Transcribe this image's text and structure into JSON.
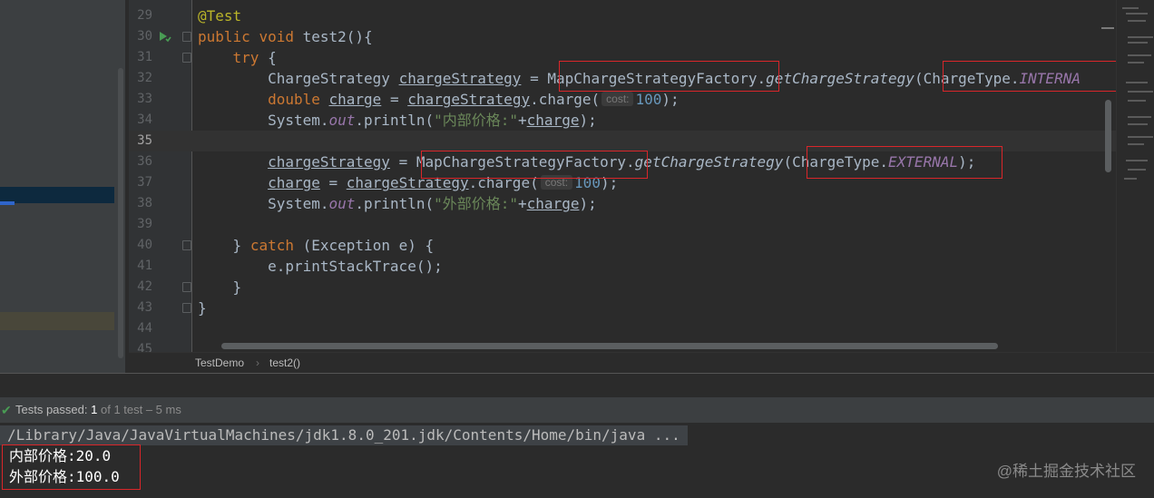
{
  "editor": {
    "lines": [
      {
        "n": "29"
      },
      {
        "n": "30"
      },
      {
        "n": "31"
      },
      {
        "n": "32"
      },
      {
        "n": "33"
      },
      {
        "n": "34"
      },
      {
        "n": "35"
      },
      {
        "n": "36"
      },
      {
        "n": "37"
      },
      {
        "n": "38"
      },
      {
        "n": "39"
      },
      {
        "n": "40"
      },
      {
        "n": "41"
      },
      {
        "n": "42"
      },
      {
        "n": "43"
      },
      {
        "n": "44"
      },
      {
        "n": "45"
      }
    ],
    "code": {
      "l29_annotation": "@Test",
      "l30_public": "public",
      "l30_void": "void",
      "l30_method": "test2",
      "l30_rest": "(){",
      "l31_try": "try",
      "l31_brace": "{",
      "l32_type": "ChargeStrategy",
      "l32_var": "chargeStrategy",
      "l32_eq": "=",
      "l32_factory": "MapChargeStrategyFactory",
      "l32_dot": ".",
      "l32_call": "getChargeStrategy",
      "l32_arg": "(ChargeType.",
      "l32_const": "INTERNA",
      "l33_double": "double",
      "l33_var": "charge",
      "l33_eq": "=",
      "l33_obj": "chargeStrategy",
      "l33_call": ".charge(",
      "l33_hint": "cost:",
      "l33_num": "100",
      "l33_end": ");",
      "l34_system": "System.",
      "l34_out": "out",
      "l34_println": ".println(",
      "l34_str": "\"内部价格:\"",
      "l34_plus": "+",
      "l34_var": "charge",
      "l34_end": ");",
      "l36_var": "chargeStrategy",
      "l36_eq": "=",
      "l36_factory": "MapChargeStrategyFactory",
      "l36_dot": ".",
      "l36_call": "getChargeStrategy",
      "l36_arg": "(ChargeType.",
      "l36_const": "EXTERNAL",
      "l36_end": ");",
      "l37_var": "charge",
      "l37_eq": "=",
      "l37_obj": "chargeStrategy",
      "l37_call": ".charge(",
      "l37_hint": "cost:",
      "l37_num": "100",
      "l37_end": ");",
      "l38_system": "System.",
      "l38_out": "out",
      "l38_println": ".println(",
      "l38_str": "\"外部价格:\"",
      "l38_plus": "+",
      "l38_var": "charge",
      "l38_end": ");",
      "l40_close": "}",
      "l40_catch": "catch",
      "l40_rest": "(Exception e) {",
      "l41_call": "e.printStackTrace();",
      "l42_close": "}",
      "l43_close": "}"
    }
  },
  "breadcrumb": {
    "class_name": "TestDemo",
    "separator": "›",
    "method_name": "test2()"
  },
  "run": {
    "status_bold": "Tests passed:",
    "status_count": "1",
    "status_rest": "of 1 test – 5 ms",
    "command": "/Library/Java/JavaVirtualMachines/jdk1.8.0_201.jdk/Contents/Home/bin/java ...",
    "output_lines": [
      "内部价格:20.0",
      "外部价格:100.0"
    ]
  },
  "watermark": "@稀土掘金技术社区",
  "colors": {
    "keyword": "#cc7832",
    "annotation": "#bbb529",
    "number": "#6897bb",
    "string": "#6a8759",
    "static_field": "#9876aa",
    "test_pass_green": "#499c54",
    "highlight_box": "#d9262a"
  },
  "icons": {
    "run_gutter": "run-test-icon",
    "status": "check-icon"
  }
}
